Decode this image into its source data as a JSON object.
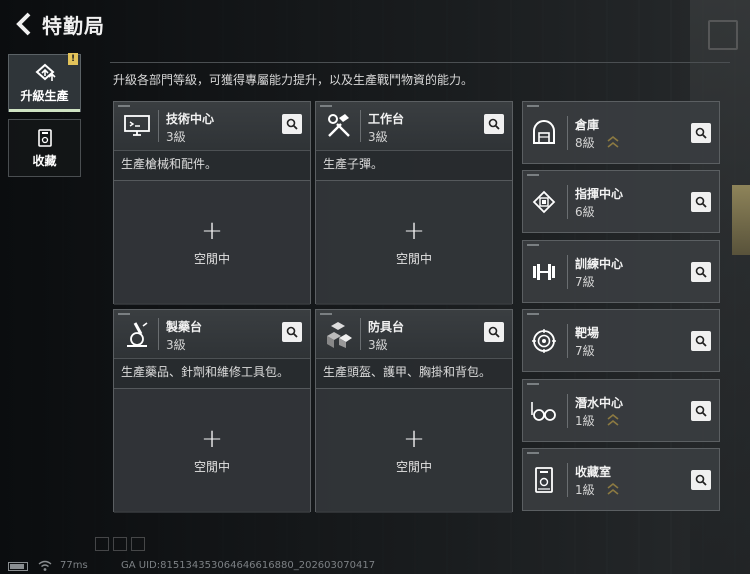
{
  "header": {
    "title": "特勤局"
  },
  "sidebar": {
    "items": [
      {
        "label": "升級生產",
        "icon": "upgrade-icon",
        "badge": "!"
      },
      {
        "label": "收藏",
        "icon": "collection-icon"
      }
    ]
  },
  "description": "升級各部門等級，可獲得專屬能力提升，以及生產戰鬥物資的能力。",
  "workshops": [
    {
      "name": "技術中心",
      "level": "3級",
      "desc": "生產槍械和配件。",
      "status": "空閒中",
      "icon": "monitor-icon"
    },
    {
      "name": "工作台",
      "level": "3級",
      "desc": "生產子彈。",
      "status": "空閒中",
      "icon": "tools-icon"
    },
    {
      "name": "製藥台",
      "level": "3級",
      "desc": "生產藥品、針劑和維修工具包。",
      "status": "空閒中",
      "icon": "microscope-icon"
    },
    {
      "name": "防具台",
      "level": "3級",
      "desc": "生產頭盔、護甲、胸掛和背包。",
      "status": "空閒中",
      "icon": "armor-boxes-icon"
    }
  ],
  "departments": [
    {
      "name": "倉庫",
      "level": "8級",
      "upgradable": true,
      "icon": "warehouse-icon"
    },
    {
      "name": "指揮中心",
      "level": "6級",
      "upgradable": false,
      "icon": "chip-icon"
    },
    {
      "name": "訓練中心",
      "level": "7級",
      "upgradable": false,
      "icon": "dumbbell-icon"
    },
    {
      "name": "靶場",
      "level": "7級",
      "upgradable": false,
      "icon": "target-icon"
    },
    {
      "name": "潛水中心",
      "level": "1級",
      "upgradable": true,
      "icon": "diving-mask-icon"
    },
    {
      "name": "收藏室",
      "level": "1級",
      "upgradable": true,
      "icon": "collection-room-icon"
    }
  ],
  "footer": {
    "ping": "77ms",
    "uid": "GA UID:815134353064646616880_202603070417"
  },
  "colors": {
    "accent": "#cfe3c3",
    "badge": "#e3c35a",
    "upgrade_chevron": "#8c7a42"
  }
}
